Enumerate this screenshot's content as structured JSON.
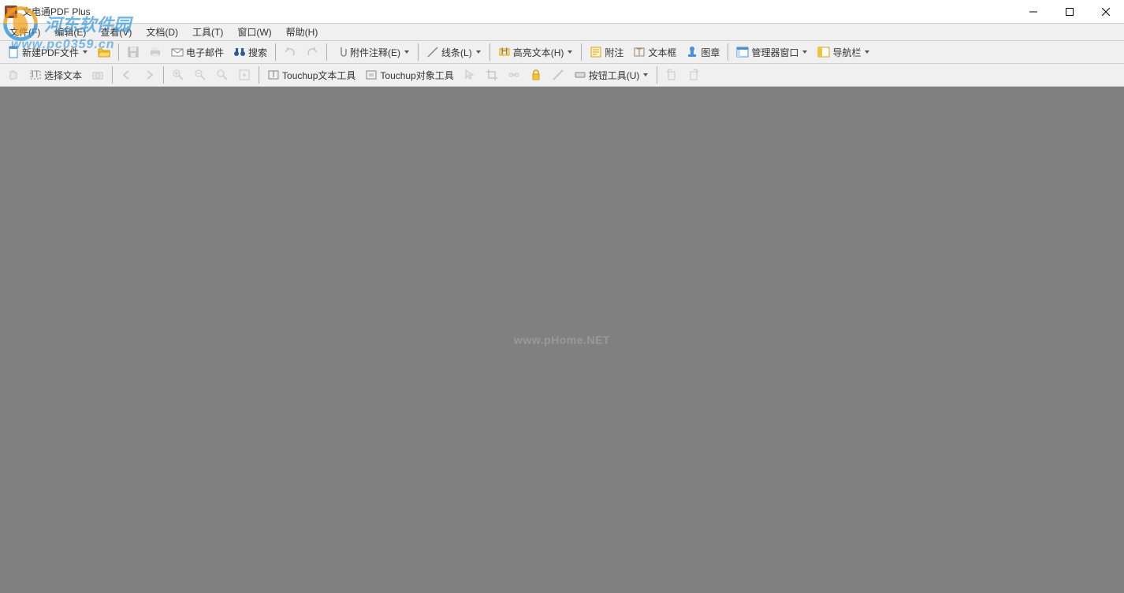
{
  "app": {
    "title": "文电通PDF Plus"
  },
  "menubar": [
    {
      "label": "文件(F)"
    },
    {
      "label": "编辑(E)"
    },
    {
      "label": "查看(V)"
    },
    {
      "label": "文档(D)"
    },
    {
      "label": "工具(T)"
    },
    {
      "label": "窗口(W)"
    },
    {
      "label": "帮助(H)"
    }
  ],
  "toolbar1": {
    "new_pdf": "新建PDF文件",
    "email": "电子邮件",
    "search": "搜索",
    "attach_comment": "附件注释(E)",
    "lines": "线条(L)",
    "highlight": "高亮文本(H)",
    "attach": "附注",
    "textbox": "文本框",
    "stamp": "图章",
    "manager_window": "管理器窗口",
    "navbar": "导航栏"
  },
  "toolbar2": {
    "select_text": "选择文本",
    "touchup_text": "Touchup文本工具",
    "touchup_object": "Touchup对象工具",
    "button_tool": "按钮工具(U)"
  },
  "content": {
    "watermark": "www.pHome.NET"
  },
  "overlay": {
    "site_name": "河东软件园",
    "site_url": "www.pc0359.cn"
  }
}
